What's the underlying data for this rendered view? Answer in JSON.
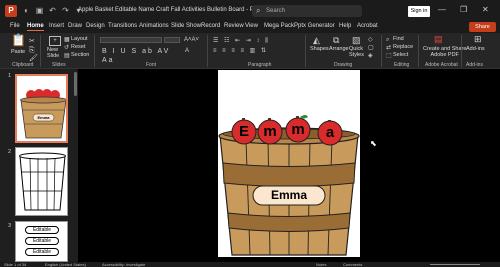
{
  "titlebar": {
    "app_icon": "powerpoint-logo",
    "title": "Apple Basket Editable Name Craft Fall Activities Bulletin Board  -  PowerP...",
    "search_placeholder": "Search",
    "signin": "Sign in",
    "minimize": "—",
    "restore": "❐",
    "close": "✕"
  },
  "tabs": [
    "File",
    "Home",
    "Insert",
    "Draw",
    "Design",
    "Transitions",
    "Animations",
    "Slide Show",
    "Record",
    "Review",
    "View",
    "Mega Pack",
    "Pptx Generator",
    "Help",
    "Acrobat"
  ],
  "share": "Share",
  "ribbon": {
    "paste": "Paste",
    "new_slide": "New\nSlide",
    "layout": "Layout",
    "reset": "Reset",
    "section": "Section",
    "shapes": "Shapes",
    "arrange": "Arrange",
    "quick_styles": "Quick\nStyles",
    "find": "Find",
    "replace": "Replace",
    "select": "Select",
    "create_share": "Create and Share\nAdobe PDF",
    "addins": "Add-ins",
    "groups": {
      "clipboard": "Clipboard",
      "slides": "Slides",
      "font": "Font",
      "paragraph": "Paragraph",
      "drawing": "Drawing",
      "editing": "Editing",
      "adobe": "Adobe Acrobat",
      "addins": "Add-ins"
    }
  },
  "thumbnails": {
    "numbers": [
      "1",
      "2",
      "3"
    ],
    "editable_labels": [
      "Editable",
      "Editable",
      "Editable"
    ],
    "thumb1_name": "Emma"
  },
  "slide": {
    "letters": [
      "E",
      "m",
      "m",
      "a"
    ],
    "name_label": "Emma",
    "colors": {
      "apple": "#d92b2b",
      "basket": "#c89a5b",
      "basket_dark": "#9a6d36",
      "label_bg": "#fbe7cf"
    }
  },
  "status": {
    "slide_info": "Slide 1 of 34",
    "language": "English (United States)",
    "accessibility": "Accessibility: Investigate",
    "notes": "Notes",
    "comments": "Comments"
  }
}
